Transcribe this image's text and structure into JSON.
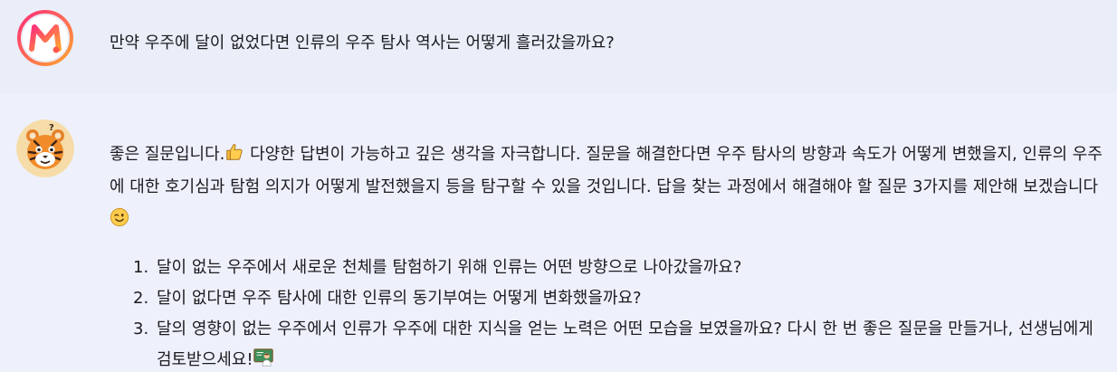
{
  "user_message": {
    "text": "만약 우주에 달이 없었다면 인류의 우주 탐사 역사는 어떻게 흘러갔을까요?"
  },
  "bot_message": {
    "intro_part1": "좋은 질문입니다.",
    "intro_part2": " 다양한 답변이 가능하고 깊은 생각을 자극합니다. 질문을 해결한다면 우주 탐사의 방향과 속도가 어떻게 변했을지, 인류의 우주에 대한 호기심과 탐험 의지가 어떻게 발전했을지 등을 탐구할 수 있을 것입니다. 답을 찾는 과정에서 해결해야 할 질문 3가지를 제안해 보겠습니다",
    "items": [
      {
        "number": "1.",
        "text": "달이 없는 우주에서 새로운 천체를 탐험하기 위해 인류는 어떤 방향으로 나아갔을까요?"
      },
      {
        "number": "2.",
        "text": "달이 없다면 우주 탐사에 대한 인류의 동기부여는 어떻게 변화했을까요?"
      },
      {
        "number": "3.",
        "text": "달의 영향이 없는 우주에서 인류가 우주에 대한 지식을 얻는 노력은 어떤 모습을 보였을까요? 다시 한 번 좋은 질문을 만들거나, 선생님에게 검토받으세요!"
      }
    ]
  },
  "icons": {
    "user_avatar": "m-logo-avatar",
    "bot_avatar": "tiger-avatar",
    "emoji_1": "thumbs-up-icon",
    "emoji_2": "winking-face-icon",
    "emoji_3": "teacher-icon"
  },
  "colors": {
    "avatar_gradient_start": "#ff2e7a",
    "avatar_gradient_end": "#ff9d2e",
    "tiger_orange": "#f08c2a",
    "background": "#eef1fb"
  }
}
